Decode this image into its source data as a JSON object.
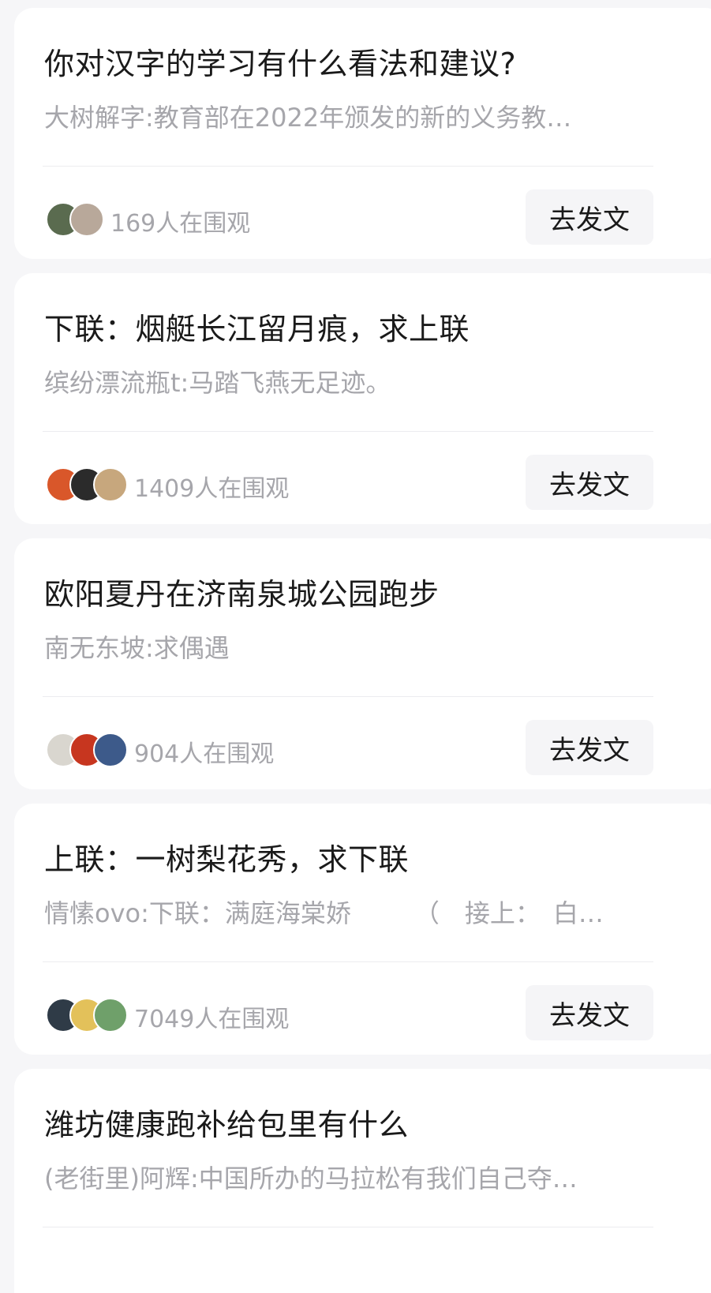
{
  "topics": [
    {
      "title": "你对汉字的学习有什么看法和建议?",
      "preview": "大树解字:教育部在2022年颁发的新的义务教…",
      "watchers": "169人在围观",
      "button": "去发文",
      "avatar_colors": [
        "#5a6b4f",
        "#b8a89a"
      ]
    },
    {
      "title": "下联：烟艇长江留月痕，求上联",
      "preview": "缤纷漂流瓶t:马踏飞燕无足迹。",
      "watchers": "1409人在围观",
      "button": "去发文",
      "avatar_colors": [
        "#d9572a",
        "#2b2b2b",
        "#c7a77d"
      ]
    },
    {
      "title": "欧阳夏丹在济南泉城公园跑步",
      "preview": "南无东坡:求偶遇",
      "watchers": "904人在围观",
      "button": "去发文",
      "avatar_colors": [
        "#d9d6cf",
        "#c7361f",
        "#3d5a8a"
      ]
    },
    {
      "title": "上联：一树梨花秀，求下联",
      "preview": "情愫ovo:下联：满庭海棠娇　　　（　接上：　白…",
      "watchers": "7049人在围观",
      "button": "去发文",
      "avatar_colors": [
        "#2f3b47",
        "#e3c15a",
        "#6fa06a"
      ]
    },
    {
      "title": "潍坊健康跑补给包里有什么",
      "preview": "(老街里)阿辉:中国所办的马拉松有我们自己夺…",
      "watchers": "",
      "button": "",
      "avatar_colors": []
    }
  ]
}
